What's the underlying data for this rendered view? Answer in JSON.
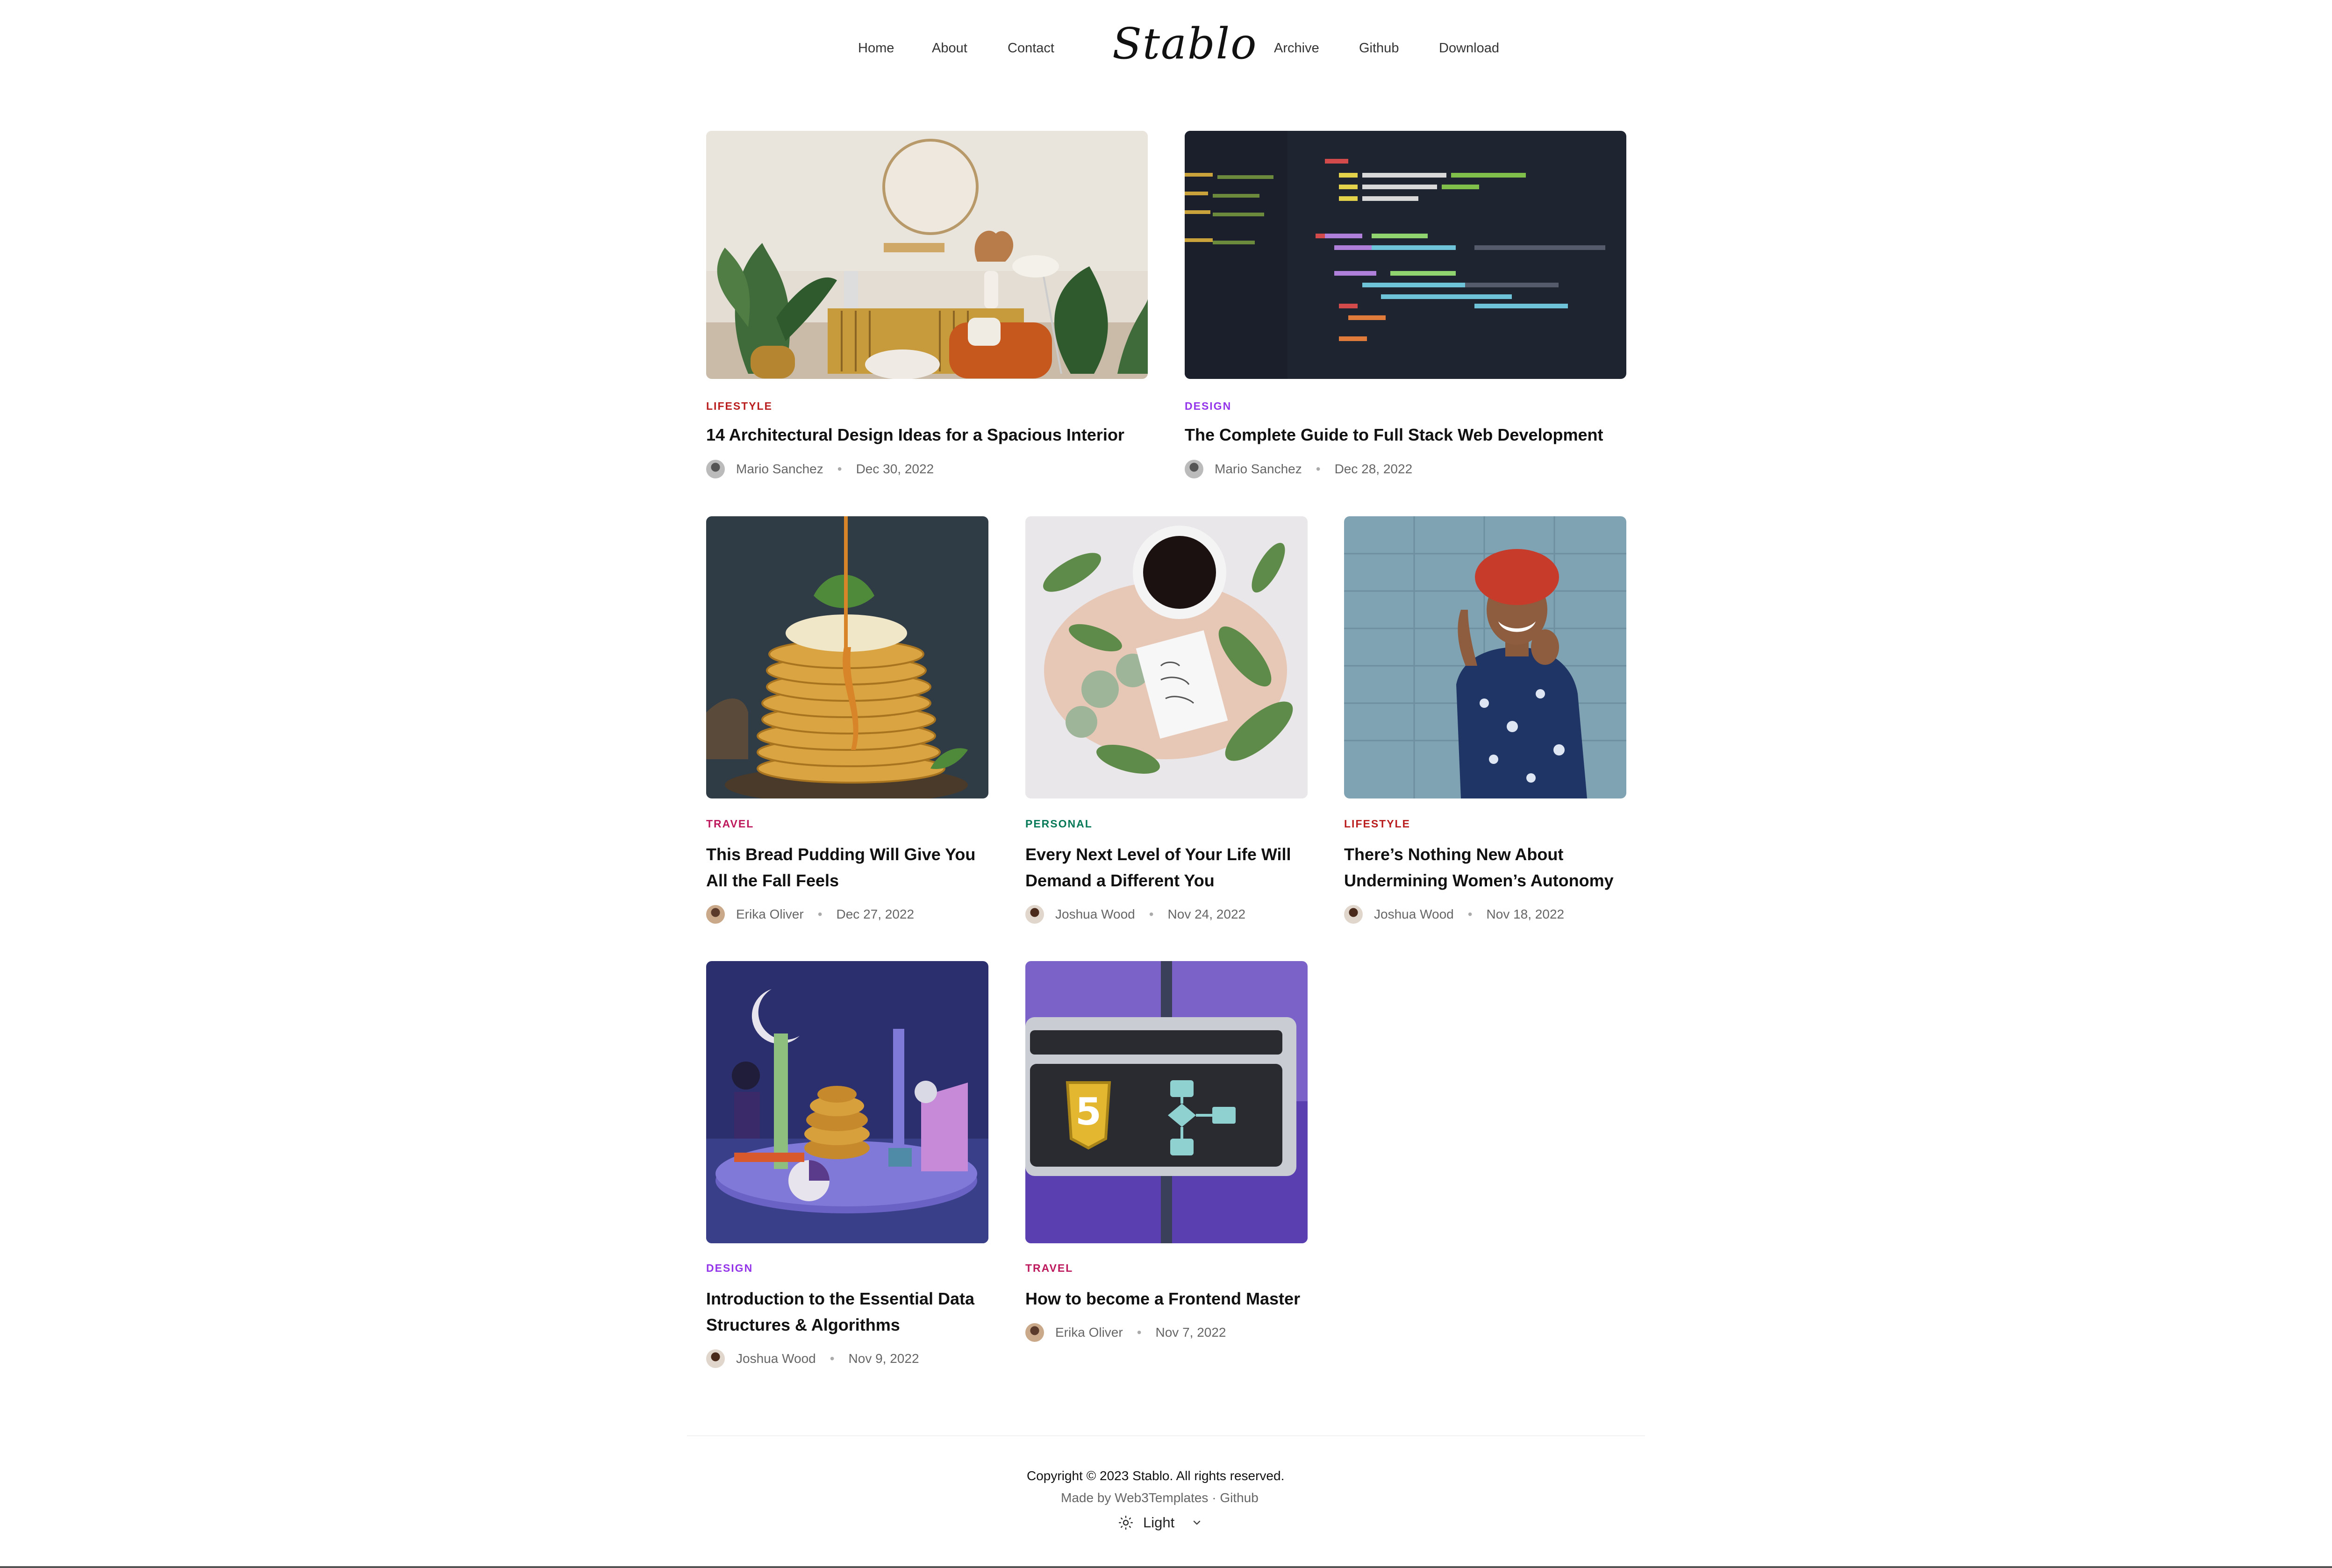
{
  "nav": {
    "left": [
      "Home",
      "About",
      "Contact"
    ],
    "logo": "Stablo",
    "right": [
      "Archive",
      "Github",
      "Download"
    ]
  },
  "posts": [
    {
      "category": "Lifestyle",
      "category_color": "#b91c1c",
      "title": "14 Architectural Design Ideas for a Spacious Interior",
      "author": "Mario Sanchez",
      "date": "Dec 30, 2022",
      "image": "living-room-photo"
    },
    {
      "category": "Design",
      "category_color": "#9333ea",
      "title": "The Complete Guide to Full Stack Web Development",
      "author": "Mario Sanchez",
      "date": "Dec 28, 2022",
      "image": "code-screen-photo"
    },
    {
      "category": "Travel",
      "category_color": "#be185d",
      "title": "This Bread Pudding Will Give You All the Fall Feels",
      "author": "Erika Oliver",
      "date": "Dec 27, 2022",
      "image": "pancakes-photo"
    },
    {
      "category": "Personal",
      "category_color": "#047857",
      "title": "Every Next Level of Your Life Will Demand a Different You",
      "author": "Joshua Wood",
      "date": "Nov 24, 2022",
      "image": "coffee-leaves-photo"
    },
    {
      "category": "Lifestyle",
      "category_color": "#b91c1c",
      "title": "There’s Nothing New About Undermining Women’s Autonomy",
      "author": "Joshua Wood",
      "date": "Nov 18, 2022",
      "image": "woman-portrait-photo"
    },
    {
      "category": "Design",
      "category_color": "#9333ea",
      "title": "Introduction to the Essential Data Structures & Algorithms",
      "author": "Joshua Wood",
      "date": "Nov 9, 2022",
      "image": "3d-shapes-render"
    },
    {
      "category": "Travel",
      "category_color": "#be185d",
      "title": "How to become a Frontend Master",
      "author": "Erika Oliver",
      "date": "Nov 7, 2022",
      "image": "js-flowchart-render"
    }
  ],
  "footer": {
    "copyright": "Copyright © 2023 Stablo. All rights reserved.",
    "made_by_prefix": "Made by ",
    "made_by_link": "Web3Templates",
    "separator": " · ",
    "github_link": "Github",
    "theme_label": "Light"
  }
}
